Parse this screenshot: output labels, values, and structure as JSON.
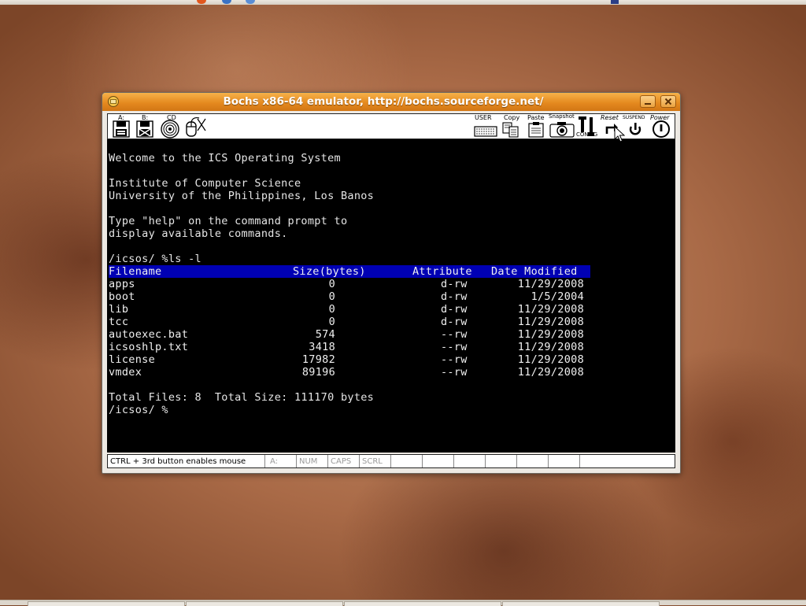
{
  "window": {
    "title": "Bochs x86-64 emulator, http://bochs.sourceforge.net/"
  },
  "toolbar": {
    "floppy_a_label": "A:",
    "floppy_b_label": "B:",
    "cdrom_label": "CD",
    "user_label": "USER",
    "copy_label": "Copy",
    "paste_label": "Paste",
    "snapshot_label": "Snapshot",
    "config_label": "CONFIG",
    "reset_label": "Reset",
    "suspend_label": "SUSPEND",
    "power_label": "Power"
  },
  "console": {
    "lines": [
      "Welcome to the ICS Operating System",
      "Institute of Computer Science",
      "University of the Philippines, Los Banos",
      "Type \"help\" on the command prompt to",
      "display available commands.",
      "/icsos/ %ls -l"
    ],
    "table": {
      "headers": [
        "Filename",
        "Size(bytes)",
        "Attribute",
        "Date Modified"
      ],
      "rows": [
        [
          "apps",
          "0",
          "d-rw",
          "11/29/2008"
        ],
        [
          "boot",
          "0",
          "d-rw",
          "1/5/2004"
        ],
        [
          "lib",
          "0",
          "d-rw",
          "11/29/2008"
        ],
        [
          "tcc",
          "0",
          "d-rw",
          "11/29/2008"
        ],
        [
          "autoexec.bat",
          "574",
          "--rw",
          "11/29/2008"
        ],
        [
          "icsoshlp.txt",
          "3418",
          "--rw",
          "11/29/2008"
        ],
        [
          "license",
          "17982",
          "--rw",
          "11/29/2008"
        ],
        [
          "vmdex",
          "89196",
          "--rw",
          "11/29/2008"
        ]
      ]
    },
    "summary": "Total Files: 8  Total Size: 111170 bytes",
    "prompt": "/icsos/ %"
  },
  "statusbar": {
    "hint": "CTRL + 3rd button enables mouse",
    "drive": "A:",
    "num": "NUM",
    "caps": "CAPS",
    "scrl": "SCRL"
  },
  "colors": {
    "titlebar": "#e58a1f",
    "console_bg": "#000000",
    "header_bar": "#0000b4"
  }
}
